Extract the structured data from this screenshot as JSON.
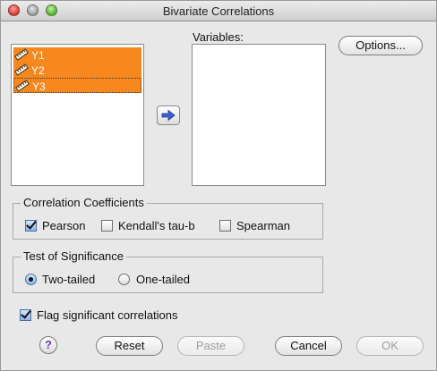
{
  "window": {
    "title": "Bivariate Correlations"
  },
  "source_list": {
    "items": [
      {
        "label": "Y1",
        "icon": "scale-measure-icon",
        "selected": true
      },
      {
        "label": "Y2",
        "icon": "scale-measure-icon",
        "selected": true
      },
      {
        "label": "Y3",
        "icon": "scale-measure-icon",
        "selected": true,
        "focused": true
      }
    ]
  },
  "variables": {
    "caption": "Variables:",
    "items": []
  },
  "buttons": {
    "options": "Options...",
    "move": "right-arrow-icon",
    "help": "?",
    "reset": "Reset",
    "paste": "Paste",
    "cancel": "Cancel",
    "ok": "OK"
  },
  "correlation_coefficients": {
    "title": "Correlation Coefficients",
    "pearson": {
      "label": "Pearson",
      "checked": true
    },
    "kendall": {
      "label": "Kendall's tau-b",
      "checked": false
    },
    "spearman": {
      "label": "Spearman",
      "checked": false
    }
  },
  "test_of_significance": {
    "title": "Test of Significance",
    "two_tailed": {
      "label": "Two-tailed",
      "selected": true
    },
    "one_tailed": {
      "label": "One-tailed",
      "selected": false
    }
  },
  "flag_significant": {
    "label": "Flag significant correlations",
    "checked": true
  },
  "colors": {
    "selection": "#f7881f",
    "arrow": "#3c5fd6",
    "help": "#6a3aa8"
  }
}
